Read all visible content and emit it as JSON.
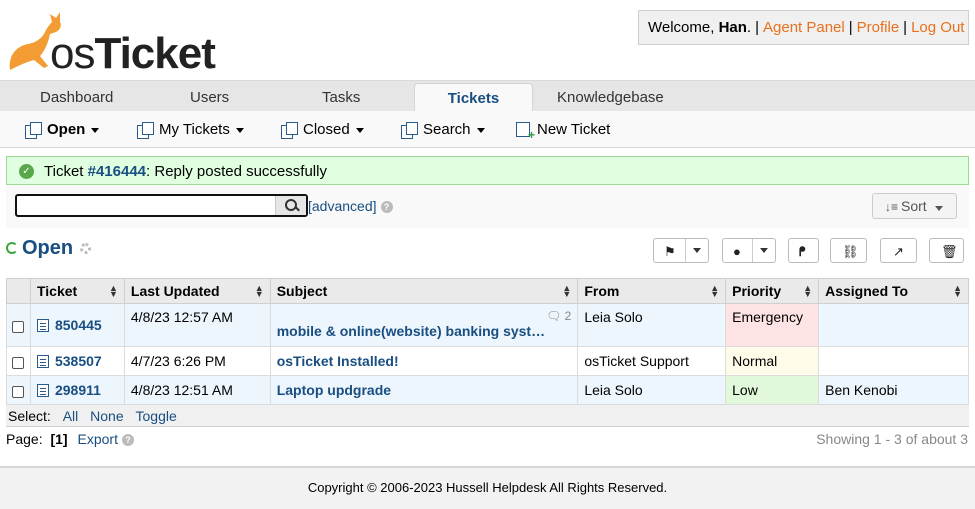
{
  "header": {
    "logo_text": "osTicket",
    "welcome_prefix": "Welcome, ",
    "user_name": "Han",
    "welcome_suffix": ".",
    "agent_panel": "Agent Panel",
    "profile": "Profile",
    "logout": "Log Out",
    "separator": "|",
    "link_color": "#e8711f"
  },
  "nav": {
    "tabs": [
      {
        "label": "Dashboard"
      },
      {
        "label": "Users"
      },
      {
        "label": "Tasks"
      },
      {
        "label": "Tickets",
        "active": true
      },
      {
        "label": "Knowledgebase"
      }
    ]
  },
  "subnav": {
    "items": [
      {
        "label": "Open",
        "icon": "tickets-icon",
        "dropdown": true
      },
      {
        "label": "My Tickets",
        "icon": "tickets-icon",
        "dropdown": true
      },
      {
        "label": "Closed",
        "icon": "tickets-icon",
        "dropdown": true
      },
      {
        "label": "Search",
        "icon": "tickets-icon",
        "dropdown": true
      },
      {
        "label": "New Ticket",
        "icon": "new-ticket-icon"
      }
    ]
  },
  "notice": {
    "prefix": "Ticket ",
    "ticket_link": "#416444",
    "suffix": ": Reply posted successfully"
  },
  "search": {
    "value": "",
    "advanced_label": "[advanced]",
    "help": "?",
    "sort_label": "Sort"
  },
  "queue": {
    "title": "Open"
  },
  "table": {
    "headers": [
      "Ticket",
      "Last Updated",
      "Subject",
      "From",
      "Priority",
      "Assigned To"
    ],
    "rows": [
      {
        "number": "850445",
        "updated": "4/8/23 12:57 AM",
        "subject": "mobile & online(website) banking syst…",
        "thread_count": "2",
        "from": "Leia Solo",
        "priority": "Emergency",
        "assigned": ""
      },
      {
        "number": "538507",
        "updated": "4/7/23 6:26 PM",
        "subject": "osTicket Installed!",
        "thread_count": "",
        "from": "osTicket Support",
        "priority": "Normal",
        "assigned": ""
      },
      {
        "number": "298911",
        "updated": "4/8/23 12:51 AM",
        "subject": "Laptop updgrade",
        "thread_count": "",
        "from": "Leia Solo",
        "priority": "Low",
        "assigned": "Ben Kenobi"
      }
    ],
    "priority_colors": {
      "Emergency": "#fde3e3",
      "Normal": "#fefce8",
      "Low": "#e2f8db"
    }
  },
  "select": {
    "label": "Select:",
    "all": "All",
    "none": "None",
    "toggle": "Toggle"
  },
  "pager": {
    "label": "Page:",
    "current": "[1]",
    "export": "Export",
    "help": "?",
    "showing": "Showing 1 - 3 of about 3"
  },
  "footer": {
    "text": "Copyright © 2006-2023 Hussell Helpdesk All Rights Reserved."
  }
}
